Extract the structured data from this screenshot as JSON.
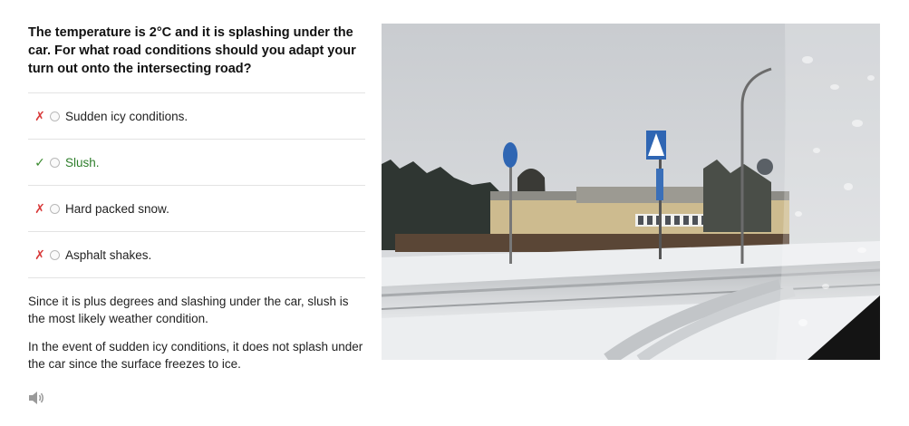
{
  "question": "The temperature is 2°C and it is splashing under the car. For what road conditions should you adapt your turn out onto the intersecting road?",
  "options": [
    {
      "label": "Sudden icy conditions.",
      "mark": "✗",
      "status": "wrong"
    },
    {
      "label": "Slush.",
      "mark": "✓",
      "status": "correct"
    },
    {
      "label": "Hard packed snow.",
      "mark": "✗",
      "status": "wrong"
    },
    {
      "label": "Asphalt shakes.",
      "mark": "✗",
      "status": "wrong"
    }
  ],
  "explanation": [
    "Since it is plus degrees and slashing under the car, slush is the most likely weather condition.",
    "In the event of sudden icy conditions, it does not splash under the car since the surface freezes to ice."
  ],
  "icons": {
    "audio": "speaker-icon",
    "wrong": "cross-icon",
    "correct": "check-icon"
  },
  "colors": {
    "wrong": "#d83a3a",
    "correct": "#2d7d2a"
  }
}
